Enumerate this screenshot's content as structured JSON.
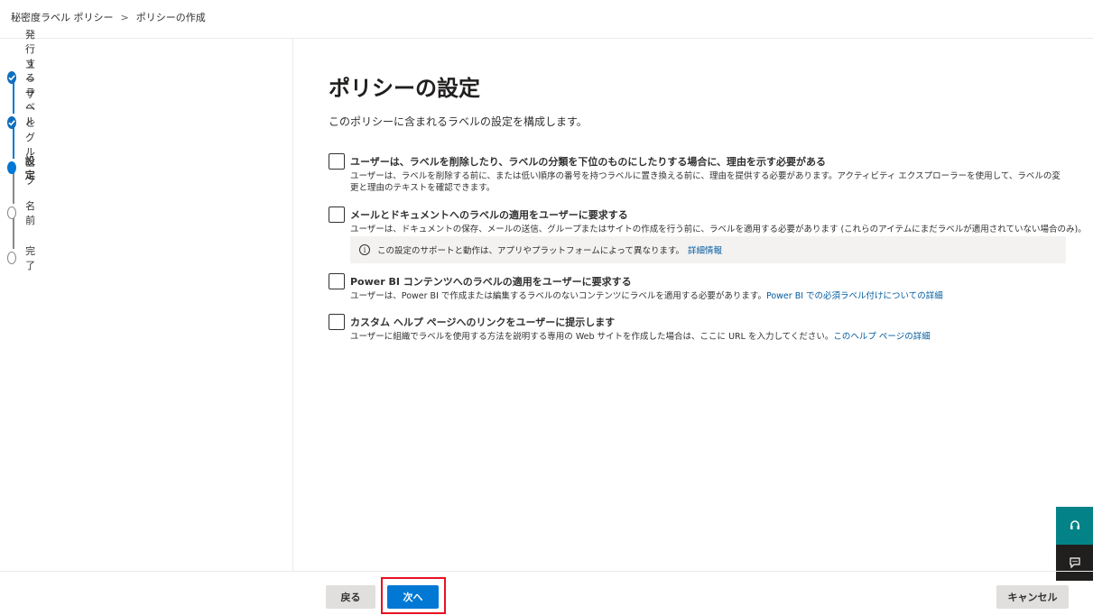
{
  "breadcrumb": {
    "parent": "秘密度ラベル ポリシー",
    "separator": ">",
    "current": "ポリシーの作成"
  },
  "steps": [
    {
      "label": "発行するラベル",
      "state": "done"
    },
    {
      "label": "ユーザーとグループ",
      "state": "done"
    },
    {
      "label": "設定",
      "state": "current"
    },
    {
      "label": "名前",
      "state": "todo"
    },
    {
      "label": "完了",
      "state": "todo"
    }
  ],
  "main": {
    "title": "ポリシーの設定",
    "description": "このポリシーに含まれるラベルの設定を構成します。",
    "options": [
      {
        "title": "ユーザーは、ラベルを削除したり、ラベルの分類を下位のものにしたりする場合に、理由を示す必要がある",
        "description": "ユーザーは、ラベルを削除する前に、または低い順序の番号を持つラベルに置き換える前に、理由を提供する必要があります。アクティビティ エクスプローラーを使用して、ラベルの変更と理由のテキストを確認できます。",
        "checked": false
      },
      {
        "title": "メールとドキュメントへのラベルの適用をユーザーに要求する",
        "description": "ユーザーは、ドキュメントの保存、メールの送信、グループまたはサイトの作成を行う前に、ラベルを適用する必要があります (これらのアイテムにまだラベルが適用されていない場合のみ)。",
        "info_text": "この設定のサポートと動作は、アプリやプラットフォームによって異なります。",
        "info_link": "詳細情報",
        "checked": false
      },
      {
        "title": "Power BI コンテンツへのラベルの適用をユーザーに要求する",
        "description": "ユーザーは、Power BI で作成または編集するラベルのないコンテンツにラベルを適用する必要があります。",
        "link": "Power BI での必須ラベル付けについての詳細",
        "checked": false
      },
      {
        "title": "カスタム ヘルプ ページへのリンクをユーザーに提示します",
        "description": "ユーザーに組織でラベルを使用する方法を説明する専用の Web サイトを作成した場合は、ここに URL を入力してください。",
        "link": "このヘルプ ページの詳細",
        "checked": false
      }
    ]
  },
  "footer": {
    "back_label": "戻る",
    "next_label": "次へ",
    "cancel_label": "キャンセル"
  },
  "colors": {
    "accent": "#0078d4",
    "highlight": "#e81123",
    "help_teal": "#038387"
  },
  "icons": {
    "step_done": "checkmark-icon",
    "help": "headset-icon",
    "feedback": "feedback-icon",
    "info": "info-icon"
  }
}
